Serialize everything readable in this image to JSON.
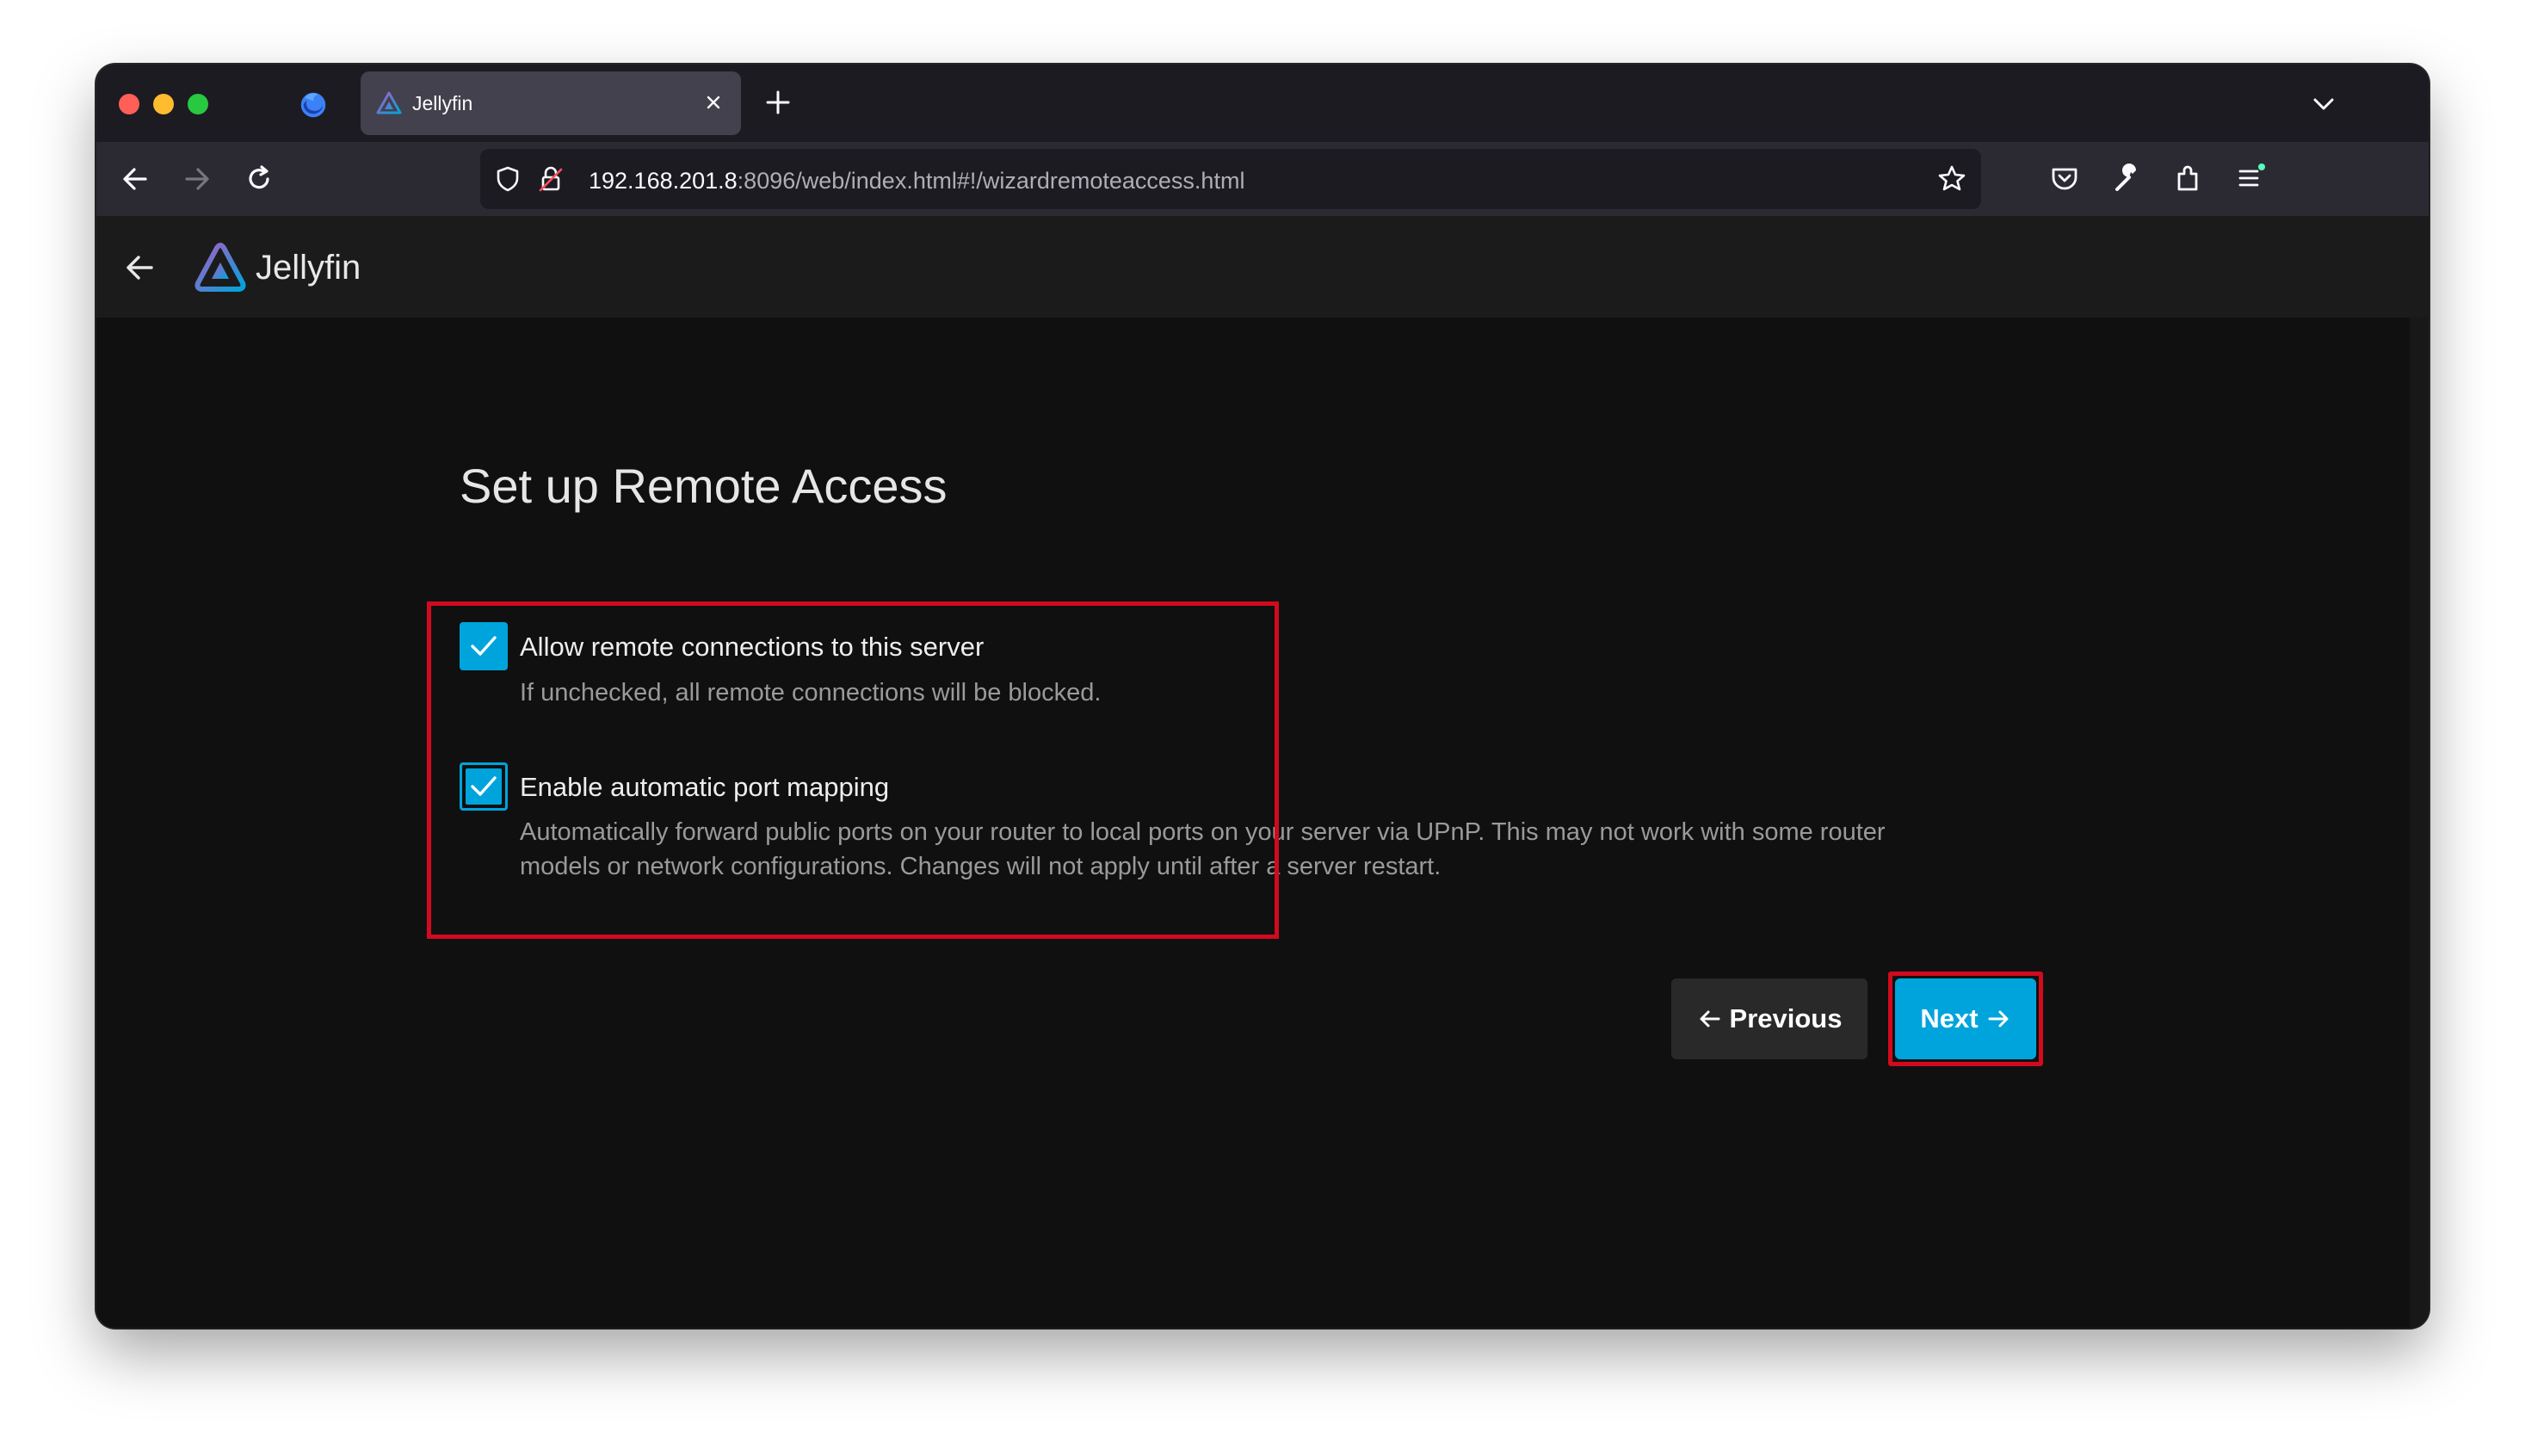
{
  "browser": {
    "tab": {
      "title": "Jellyfin"
    },
    "url": {
      "host": "192.168.201.8",
      "rest": ":8096/web/index.html#!/wizardremoteaccess.html"
    }
  },
  "app": {
    "name": "Jellyfin"
  },
  "wizard": {
    "title": "Set up Remote Access",
    "options": [
      {
        "label": "Allow remote connections to this server",
        "checked": true,
        "description": [
          "If unchecked, all remote connections will be blocked."
        ]
      },
      {
        "label": "Enable automatic port mapping",
        "checked": true,
        "description": [
          "Automatically forward public ports on your router to local ports on your server via UPnP. This may not work with some router",
          "models or network configurations. Changes will not apply until after a server restart."
        ]
      }
    ],
    "buttons": {
      "previous": "Previous",
      "next": "Next"
    }
  },
  "colors": {
    "accent": "#00a4dc",
    "highlight": "#d10a1e",
    "background": "#101010"
  }
}
